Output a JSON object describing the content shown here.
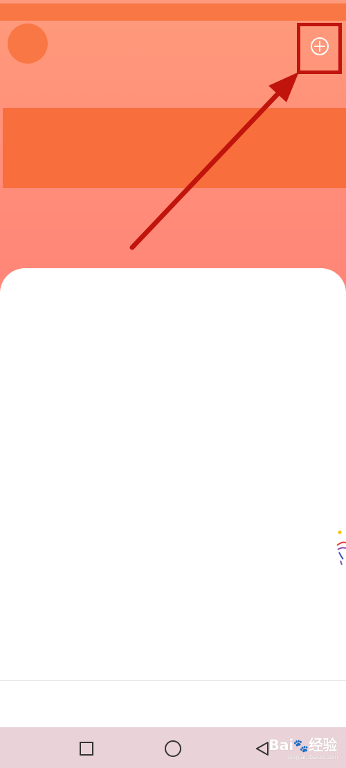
{
  "header": {
    "avatar_icon": "avatar-icon",
    "add_icon": "plus-circle-icon"
  },
  "annotation": {
    "highlight_color": "#c0140c",
    "arrow_color": "#c0140c"
  },
  "colors": {
    "accent": "#f97745",
    "banner": "#f96e3d",
    "gradient_top": "#ff9b7c",
    "gradient_bottom": "#ff7f78",
    "nav_bar": "#e9d3d8"
  },
  "nav": {
    "recents_icon": "square-icon",
    "home_icon": "circle-icon",
    "back_icon": "triangle-back-icon"
  },
  "watermark": {
    "brand": "Bai",
    "brand_suffix": "经验",
    "url": "jingyan.baidu.com"
  }
}
